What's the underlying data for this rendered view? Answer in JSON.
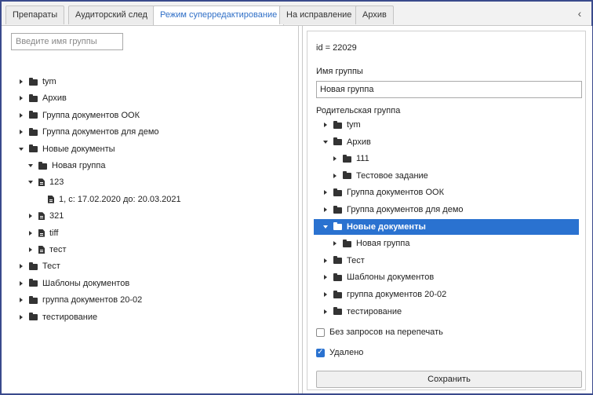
{
  "tabs": [
    {
      "label": "Препараты"
    },
    {
      "label": "Аудиторский след"
    },
    {
      "label": "Режим суперредактирование"
    },
    {
      "label": "На исправление"
    },
    {
      "label": "Архив"
    }
  ],
  "active_tab_index": 2,
  "left_panel": {
    "search_placeholder": "Введите имя группы",
    "tree": [
      {
        "label": "tym",
        "icon": "folder-icon",
        "arrow": "collapsed",
        "depth": 0
      },
      {
        "label": "Архив",
        "icon": "folder-icon",
        "arrow": "collapsed",
        "depth": 0
      },
      {
        "label": "Группа документов ООК",
        "icon": "folder-icon",
        "arrow": "collapsed",
        "depth": 0
      },
      {
        "label": "Группа документов для демо",
        "icon": "folder-icon",
        "arrow": "collapsed",
        "depth": 0
      },
      {
        "label": "Новые документы",
        "icon": "folder-icon",
        "arrow": "expanded",
        "depth": 0
      },
      {
        "label": "Новая группа",
        "icon": "folder-icon",
        "arrow": "expanded",
        "depth": 1
      },
      {
        "label": "123",
        "icon": "document-icon",
        "arrow": "expanded",
        "depth": 1
      },
      {
        "label": "1, с: 17.02.2020 до: 20.03.2021",
        "icon": "document-icon",
        "arrow": "none",
        "depth": 2
      },
      {
        "label": "321",
        "icon": "document-icon",
        "arrow": "collapsed",
        "depth": 1
      },
      {
        "label": "tiff",
        "icon": "document-icon",
        "arrow": "collapsed",
        "depth": 1
      },
      {
        "label": "тест",
        "icon": "document-icon",
        "arrow": "collapsed",
        "depth": 1
      },
      {
        "label": "Тест",
        "icon": "folder-icon",
        "arrow": "collapsed",
        "depth": 0
      },
      {
        "label": "Шаблоны документов",
        "icon": "folder-icon",
        "arrow": "collapsed",
        "depth": 0
      },
      {
        "label": "группа документов 20-02",
        "icon": "folder-icon",
        "arrow": "collapsed",
        "depth": 0
      },
      {
        "label": "тестирование",
        "icon": "folder-icon",
        "arrow": "collapsed",
        "depth": 0
      }
    ]
  },
  "right_panel": {
    "id_text": "id = 22029",
    "name_label": "Имя группы",
    "name_value": "Новая группа",
    "parent_label": "Родительская группа",
    "tree": [
      {
        "label": "tym",
        "icon": "folder-icon",
        "arrow": "collapsed",
        "depth": 0
      },
      {
        "label": "Архив",
        "icon": "folder-icon",
        "arrow": "expanded",
        "depth": 0
      },
      {
        "label": "111",
        "icon": "folder-icon",
        "arrow": "collapsed",
        "depth": 1
      },
      {
        "label": "Тестовое задание",
        "icon": "folder-icon",
        "arrow": "collapsed",
        "depth": 1
      },
      {
        "label": "Группа документов ООК",
        "icon": "folder-icon",
        "arrow": "collapsed",
        "depth": 0
      },
      {
        "label": "Группа документов для демо",
        "icon": "folder-icon",
        "arrow": "collapsed",
        "depth": 0
      },
      {
        "label": "Новые документы",
        "icon": "folder-icon",
        "arrow": "expanded",
        "depth": 0,
        "selected": true
      },
      {
        "label": "Новая группа",
        "icon": "folder-icon",
        "arrow": "collapsed",
        "depth": 1
      },
      {
        "label": "Тест",
        "icon": "folder-icon",
        "arrow": "collapsed",
        "depth": 0
      },
      {
        "label": "Шаблоны документов",
        "icon": "folder-icon",
        "arrow": "collapsed",
        "depth": 0
      },
      {
        "label": "группа документов 20-02",
        "icon": "folder-icon",
        "arrow": "collapsed",
        "depth": 0
      },
      {
        "label": "тестирование",
        "icon": "folder-icon",
        "arrow": "collapsed",
        "depth": 0
      }
    ],
    "checkbox_no_requests": {
      "label": "Без запросов на перепечать",
      "checked": false
    },
    "checkbox_deleted": {
      "label": "Удалено",
      "checked": true
    },
    "save_label": "Сохранить"
  },
  "colors": {
    "accent": "#2a72d0",
    "frame": "#3a4a8c"
  }
}
